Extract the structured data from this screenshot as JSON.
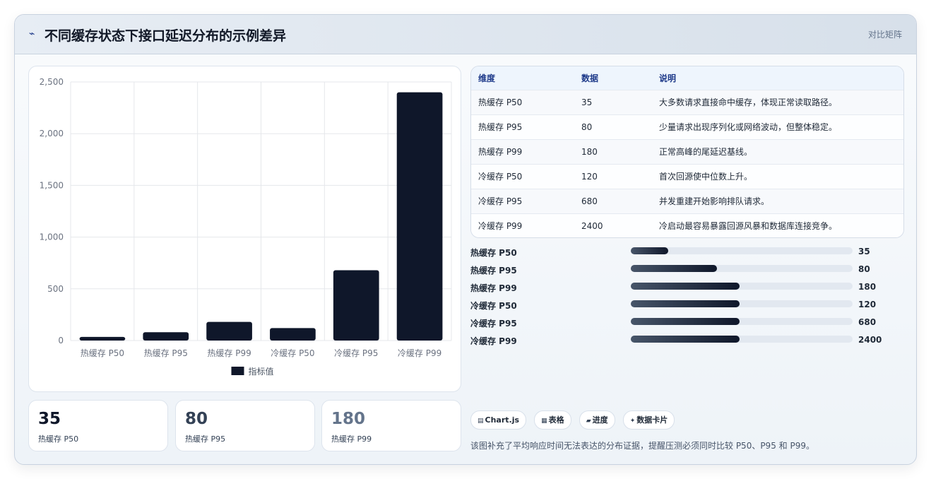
{
  "header": {
    "icon": "lightning-icon",
    "title": "不同缓存状态下接口延迟分布的示例差异",
    "tag": "对比矩阵"
  },
  "chart_data": {
    "type": "bar",
    "categories": [
      "热缓存 P50",
      "热缓存 P95",
      "热缓存 P99",
      "冷缓存 P50",
      "冷缓存 P95",
      "冷缓存 P99"
    ],
    "series": [
      {
        "name": "指标值",
        "values": [
          35,
          80,
          180,
          120,
          680,
          2400
        ]
      }
    ],
    "yticks": [
      "0",
      "500",
      "1,000",
      "1,500",
      "2,000",
      "2,500"
    ],
    "ylim": [
      0,
      2500
    ],
    "grid": true,
    "legend": "bottom",
    "bar_color": "#0f172a"
  },
  "table": {
    "headers": [
      "维度",
      "数据",
      "说明"
    ],
    "rows": [
      [
        "热缓存 P50",
        "35",
        "大多数请求直接命中缓存，体现正常读取路径。"
      ],
      [
        "热缓存 P95",
        "80",
        "少量请求出现序列化或网络波动，但整体稳定。"
      ],
      [
        "热缓存 P99",
        "180",
        "正常高峰的尾延迟基线。"
      ],
      [
        "冷缓存 P50",
        "120",
        "首次回源使中位数上升。"
      ],
      [
        "冷缓存 P95",
        "680",
        "并发重建开始影响排队请求。"
      ],
      [
        "冷缓存 P99",
        "2400",
        "冷启动最容易暴露回源风暴和数据库连接竞争。"
      ]
    ]
  },
  "progress": [
    {
      "label": "热缓存 P50",
      "value": "35",
      "fill": 0.17
    },
    {
      "label": "热缓存 P95",
      "value": "80",
      "fill": 0.39
    },
    {
      "label": "热缓存 P99",
      "value": "180",
      "fill": 0.49
    },
    {
      "label": "冷缓存 P50",
      "value": "120",
      "fill": 0.49
    },
    {
      "label": "冷缓存 P95",
      "value": "680",
      "fill": 0.49
    },
    {
      "label": "冷缓存 P99",
      "value": "2400",
      "fill": 0.49
    }
  ],
  "stats": [
    {
      "value": "35",
      "label": "热缓存 P50",
      "color": "#0f172a"
    },
    {
      "value": "80",
      "label": "热缓存 P95",
      "color": "#334155"
    },
    {
      "value": "180",
      "label": "热缓存 P99",
      "color": "#64748b"
    }
  ],
  "chips": [
    {
      "icon": "▤",
      "label": "Chart.js"
    },
    {
      "icon": "▦",
      "label": "表格"
    },
    {
      "icon": "▰",
      "label": "进度"
    },
    {
      "icon": "✦",
      "label": "数据卡片"
    }
  ],
  "note": "该图补充了平均响应时间无法表达的分布证据，提醒压测必须同时比较 P50、P95 和 P99。"
}
